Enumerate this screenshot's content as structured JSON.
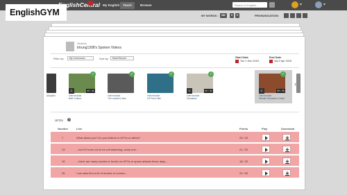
{
  "brand": {
    "overlay_text": "EnglishGYM",
    "logo": "EnglishCentral"
  },
  "nav": {
    "items": [
      "My English",
      "Teach",
      "Browse"
    ],
    "active": "Teach"
  },
  "search": {
    "placeholder": "Search in English..."
  },
  "subbar": {
    "my_words_label": "MY WORDS :",
    "my_words_count": "281",
    "pill2": "0",
    "pill3": "0",
    "pronunciation_label": "PRONUNCIATION:"
  },
  "student": {
    "label": "Students",
    "name": "trtrung1308's Spoken Videos"
  },
  "filters": {
    "filter_by_label": "Filter by:",
    "filter_by_value": "My Curriculum",
    "sort_by_label": "Sort by:",
    "sort_by_value": "Most Recent",
    "start_date_label": "Start Date",
    "start_date_value": "Tue 1 Dec 2015",
    "end_date_label": "End Date",
    "end_date_value": "Sat 2 Apr 2016"
  },
  "videos": [
    {
      "level": "",
      "points": "",
      "level_text": "Intermediate",
      "title": "Adoption",
      "color": "#3c3c3c"
    },
    {
      "level": "C",
      "points": "49 / 52",
      "level_text": "Intermediate",
      "title": "Bath Culture",
      "color": "#6b8a4e"
    },
    {
      "level": "",
      "points": "",
      "level_text": "Intermediate",
      "title": "The Leader's Idea",
      "color": "#5a5a5a"
    },
    {
      "level": "",
      "points": "",
      "level_text": "Intermediate",
      "title": "Oil Price Hike",
      "color": "#2f6f88"
    },
    {
      "level": "C",
      "points": "49 / 52",
      "level_text": "Intermediate",
      "title": "Donations",
      "color": "#c9c4b8"
    },
    {
      "level": "C",
      "points": "95 / 95",
      "level_text": "Intermediate",
      "title": "Wrinkle Education Center",
      "color": "#8c4b2d"
    },
    {
      "level": "",
      "points": "",
      "level_text": "Interm.",
      "title": "",
      "color": "#888888"
    }
  ],
  "table": {
    "section_title": "UFOs",
    "headers": {
      "number": "Number",
      "line": "Line",
      "points": "Points",
      "play": "Play",
      "download": "Download"
    },
    "rows": [
      {
        "number": "7",
        "line": "What about you? Do you believe in UFOs or aliens?",
        "points": "28 / 32"
      },
      {
        "number": "13",
        "line": "...but if it turns out to be a threatening, scary one...",
        "points": "21 / 32"
      },
      {
        "number": "16",
        "line": "...there are many movies or books on UFOs or space attacks these days...",
        "points": "18 / 32"
      },
      {
        "number": "26",
        "line": "I can also find a lot of movies or comics...",
        "points": "24 / 50"
      }
    ]
  },
  "colors": {
    "topbar": "#4a4a4a",
    "accent": "#c0262d",
    "row_highlight": "#f2a5a5",
    "check": "#53a653"
  }
}
